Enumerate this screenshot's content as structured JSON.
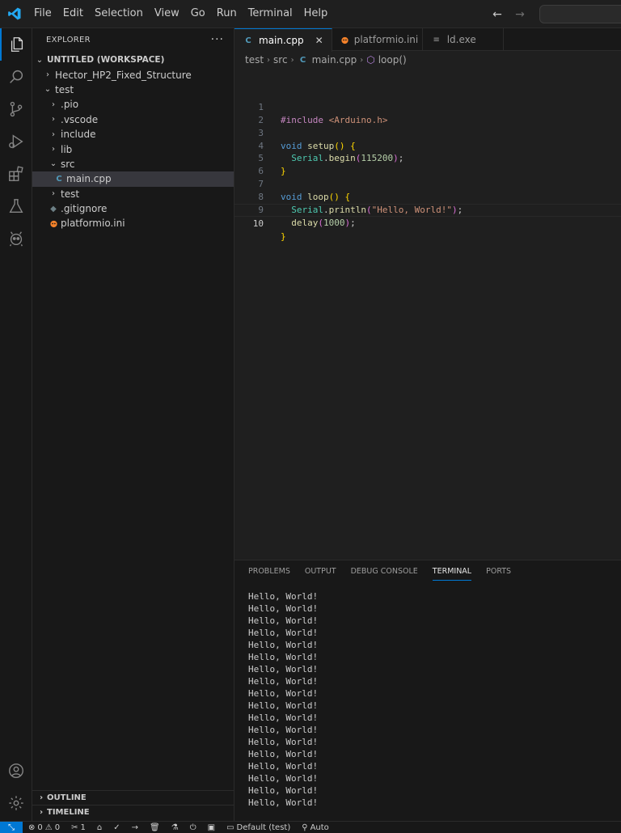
{
  "menu": [
    "File",
    "Edit",
    "Selection",
    "View",
    "Go",
    "Run",
    "Terminal",
    "Help"
  ],
  "nav": {
    "back": "←",
    "forward": "→"
  },
  "colors": {
    "accent": "#0078d4",
    "logo": "#23a9f2",
    "platformio": "#f5822a"
  },
  "activity": [
    "explorer-icon",
    "search-icon",
    "source-control-icon",
    "run-debug-icon",
    "extensions-icon",
    "testing-icon",
    "platformio-icon",
    "account-icon",
    "settings-gear-icon"
  ],
  "sidebar": {
    "title": "EXPLORER",
    "more": "···",
    "workspace": "UNTITLED (WORKSPACE)",
    "items": [
      {
        "label": "Hector_HP2_Fixed_Structure",
        "chev": "›"
      },
      {
        "label": "test",
        "chev": "⌄"
      },
      {
        "label": ".pio",
        "chev": "›"
      },
      {
        "label": ".vscode",
        "chev": "›"
      },
      {
        "label": "include",
        "chev": "›"
      },
      {
        "label": "lib",
        "chev": "›"
      },
      {
        "label": "src",
        "chev": "⌄"
      },
      {
        "label": "main.cpp",
        "icon": "C"
      },
      {
        "label": "test",
        "chev": "›"
      },
      {
        "label": ".gitignore",
        "icon": "◆"
      },
      {
        "label": "platformio.ini",
        "icon": "👾"
      }
    ],
    "outline": "OUTLINE",
    "timeline": "TIMELINE"
  },
  "tabs": [
    {
      "label": "main.cpp",
      "close": "✕"
    },
    {
      "label": "platformio.ini"
    },
    {
      "label": "ld.exe"
    }
  ],
  "breadcrumb": [
    "test",
    "src",
    "main.cpp",
    "loop()"
  ],
  "code": {
    "line_numbers": [
      "1",
      "2",
      "3",
      "4",
      "5",
      "6",
      "7",
      "8",
      "9",
      "10"
    ],
    "l1_pp": "#include",
    "l1_inc": "<Arduino.h>",
    "l3_kw": "void",
    "l3_fn": "setup",
    "l4_obj": "Serial",
    "l4_fn": "begin",
    "l4_num": "115200",
    "l7_kw": "void",
    "l7_fn": "loop",
    "l8_obj": "Serial",
    "l8_fn": "println",
    "l8_str": "\"Hello, World!\"",
    "l9_fn": "delay",
    "l9_num": "1000"
  },
  "panel": {
    "tabs": [
      "PROBLEMS",
      "OUTPUT",
      "DEBUG CONSOLE",
      "TERMINAL",
      "PORTS"
    ],
    "terminal_lines": [
      "Hello, World!",
      "Hello, World!",
      "Hello, World!",
      "Hello, World!",
      "Hello, World!",
      "Hello, World!",
      "Hello, World!",
      "Hello, World!",
      "Hello, World!",
      "Hello, World!",
      "Hello, World!",
      "Hello, World!",
      "Hello, World!",
      "Hello, World!",
      "Hello, World!",
      "Hello, World!",
      "Hello, World!",
      "Hello, World!"
    ]
  },
  "status": {
    "remote": "⤡",
    "errors": "0",
    "warnings": "0",
    "ports": "1",
    "env": "Default (test)",
    "auto": "Auto"
  }
}
